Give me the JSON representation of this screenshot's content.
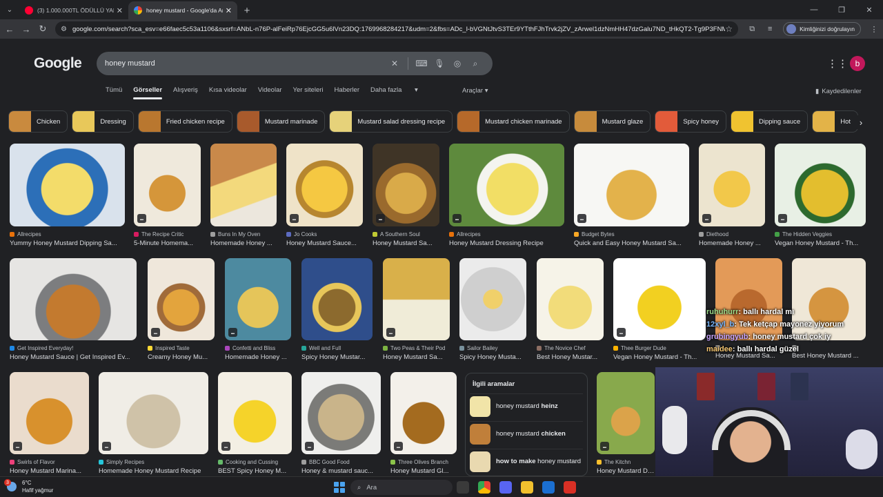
{
  "browser": {
    "tabs": [
      {
        "title": "(3) 1.000.000TL ÖDÜLLÜ YARIŞ...",
        "favicon": "youtube-icon"
      },
      {
        "title": "honey mustard - Google'da Ara",
        "favicon": "google-icon"
      }
    ],
    "url": "google.com/search?sca_esv=e66faec5c53a1106&sxsrf=ANbL-n76P-alFeiRp76EjcGG5u6lVn23DQ:1769968284217&udm=2&fbs=ADc_l-bVGNtJtvS3TEr9YTthFJhTrvk2jZV_zArwel1dzNmHH47dzGalu7ND_tHkQT2-Tg9P3FNMLYc1_O...",
    "identity_button": "Kimliğinizi doğrulayın"
  },
  "search": {
    "query": "honey mustard",
    "logo": "Google",
    "avatar_letter": "b"
  },
  "nav": {
    "tabs": [
      "Tümü",
      "Görseller",
      "Alışveriş",
      "Kısa videolar",
      "Videolar",
      "Yer siteleri",
      "Haberler",
      "Daha fazla"
    ],
    "active": "Görseller",
    "tools": "Araçlar",
    "saved": "Kaydedilenler"
  },
  "chips": [
    {
      "label": "Chicken"
    },
    {
      "label": "Dressing"
    },
    {
      "label": "Fried chicken recipe"
    },
    {
      "label": "Mustard marinade"
    },
    {
      "label": "Mustard salad dressing recipe"
    },
    {
      "label": "Mustard chicken marinade"
    },
    {
      "label": "Mustard glaze"
    },
    {
      "label": "Spicy honey"
    },
    {
      "label": "Dipping sauce"
    },
    {
      "label": "Hot"
    }
  ],
  "results": [
    {
      "source": "Allrecipes",
      "title": "Yummy Honey Mustard Dipping Sa...",
      "color": "#e8710a"
    },
    {
      "source": "The Recipe Critic",
      "title": "5-Minute Homema...",
      "color": "#d81b60"
    },
    {
      "source": "Buns In My Oven",
      "title": "Homemade Honey ...",
      "color": "#9e9e9e"
    },
    {
      "source": "Jo Cooks",
      "title": "Honey Mustard Sauce...",
      "color": "#5c6bc0"
    },
    {
      "source": "A Southern Soul",
      "title": "Honey Mustard Sa...",
      "color": "#c0ca33"
    },
    {
      "source": "Allrecipes",
      "title": "Honey Mustard Dressing Recipe",
      "color": "#e8710a"
    },
    {
      "source": "Budget Bytes",
      "title": "Quick and Easy Honey Mustard Sa...",
      "color": "#f9a825"
    },
    {
      "source": "Diethood",
      "title": "Homemade Honey ...",
      "color": "#9e9e9e"
    },
    {
      "source": "The Hidden Veggies",
      "title": "Vegan Honey Mustard - Th...",
      "color": "#43a047"
    },
    {
      "source": "Get Inspired Everyday!",
      "title": "Honey Mustard Sauce | Get Inspired Ev...",
      "color": "#1e88e5"
    },
    {
      "source": "Inspired Taste",
      "title": "Creamy Honey Mu...",
      "color": "#fdd835"
    },
    {
      "source": "Confetti and Bliss",
      "title": "Homemade Honey ...",
      "color": "#ab47bc"
    },
    {
      "source": "Well and Full",
      "title": "Spicy Honey Mustar...",
      "color": "#26a69a"
    },
    {
      "source": "Two Peas & Their Pod",
      "title": "Honey Mustard Sa...",
      "color": "#7cb342"
    },
    {
      "source": "Sailor Bailey",
      "title": "Spicy Honey Musta...",
      "color": "#78909c"
    },
    {
      "source": "The Novice Chef",
      "title": "Best Honey Mustar...",
      "color": "#8d6e63"
    },
    {
      "source": "Thee Burger Dude",
      "title": "Vegan Honey Mustard - Th...",
      "color": "#ffb300"
    },
    {
      "source": "",
      "title": "Honey Mustard Sa...",
      "color": "#9e9e9e"
    },
    {
      "source": "",
      "title": "Best Honey Mustard ...",
      "color": "#9e9e9e"
    },
    {
      "source": "Swirls of Flavor",
      "title": "Honey Mustard Marina...",
      "color": "#ec407a"
    },
    {
      "source": "Simply Recipes",
      "title": "Homemade Honey Mustard Recipe",
      "color": "#26c6da"
    },
    {
      "source": "Cooking and Cussing",
      "title": "BEST Spicy Honey M...",
      "color": "#66bb6a"
    },
    {
      "source": "BBC Good Food",
      "title": "Honey & mustard sauc...",
      "color": "#9e9e9e"
    },
    {
      "source": "Three Olives Branch",
      "title": "Honey Mustard Gl...",
      "color": "#8bc34a"
    },
    {
      "source": "The Kitchn",
      "title": "Honey Mustard Dre...",
      "color": "#fbc02d"
    }
  ],
  "related": {
    "heading": "İlgili aramalar",
    "items": [
      {
        "normal": "honey mustard ",
        "bold": "heinz"
      },
      {
        "normal": "honey mustard ",
        "bold": "chicken"
      },
      {
        "bold": "how to make",
        "normal": " honey mustard"
      }
    ]
  },
  "chat": [
    {
      "user": "ruhuhurr",
      "message": ": ballı hardal mı"
    },
    {
      "user": "12xyl_b",
      "message": ": Tek ketçap mayonez yiyorum"
    },
    {
      "user": "grubingyub",
      "message": ": honey mustard çok iy"
    },
    {
      "user": "maidee",
      "message": ": ballı hardal güzel"
    }
  ],
  "taskbar": {
    "temperature": "6°C",
    "condition": "Hafif yağmur",
    "notification_count": "3",
    "search_placeholder": "Ara"
  },
  "colors": {
    "background": "#202124",
    "accent_avatar": "#c2185b"
  }
}
